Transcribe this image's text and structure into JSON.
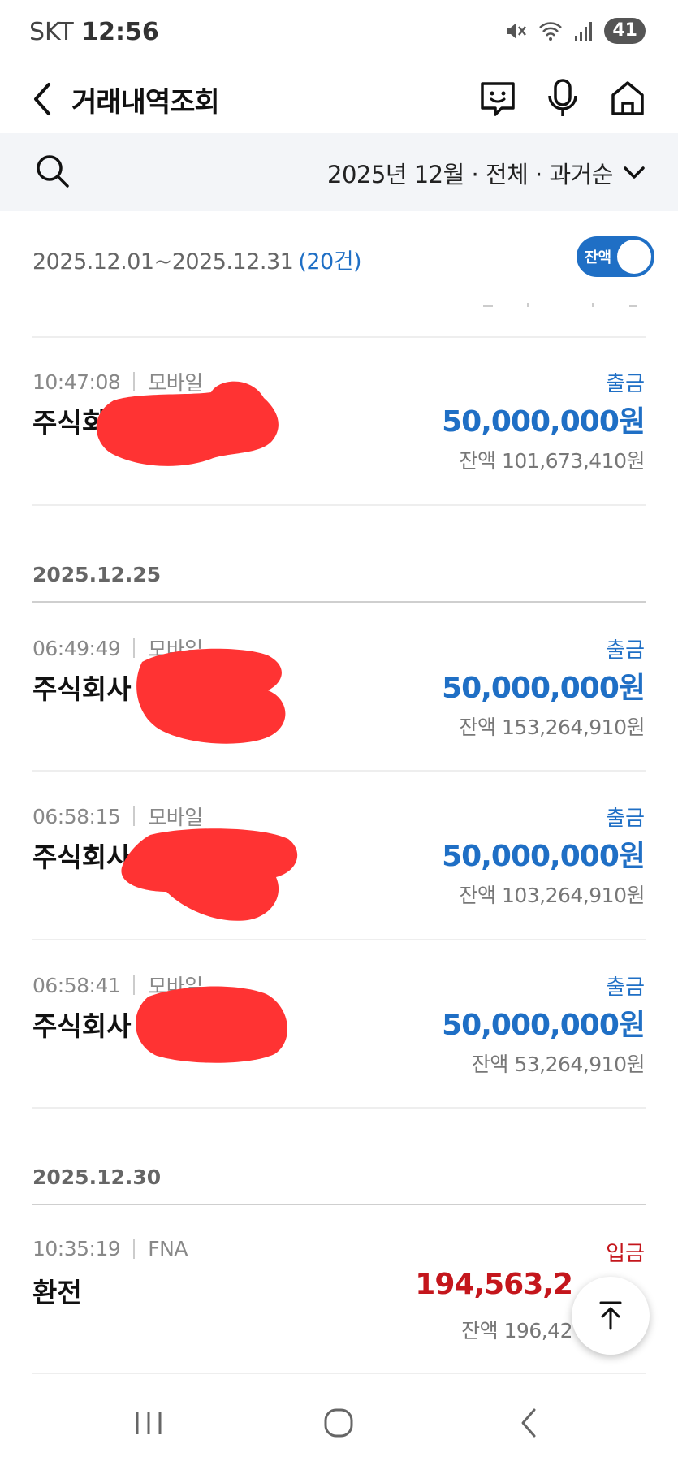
{
  "status": {
    "carrier": "SKT",
    "time": "12:56",
    "battery": "41"
  },
  "header": {
    "title": "거래내역조회"
  },
  "filter": {
    "summary": "2025년 12월 · 전체 · 과거순"
  },
  "range": {
    "period": "2025.12.01~2025.12.31",
    "count": "(20건)",
    "balance_toggle_label": "잔액"
  },
  "transactions": [
    {
      "time": "10:47:08",
      "channel": "모바일",
      "name": "주식회",
      "type": "출금",
      "amount": "50,000,000원",
      "balance": "잔액 101,673,410원"
    },
    {
      "time": "06:49:49",
      "channel": "모바일",
      "name": "주식회사",
      "type": "출금",
      "amount": "50,000,000원",
      "balance": "잔액 153,264,910원"
    },
    {
      "time": "06:58:15",
      "channel": "모바일",
      "name": "주식회사",
      "type": "출금",
      "amount": "50,000,000원",
      "balance": "잔액 103,264,910원"
    },
    {
      "time": "06:58:41",
      "channel": "모바일",
      "name": "주식회사",
      "type": "출금",
      "amount": "50,000,000원",
      "balance": "잔액 53,264,910원"
    },
    {
      "time": "10:35:19",
      "channel": "FNA",
      "name": "환전",
      "type": "입금",
      "amount": "194,563,2",
      "balance": "잔액 196,42"
    }
  ],
  "dates": [
    "2025.12.25",
    "2025.12.30"
  ],
  "colors": {
    "withdrawal": "#1f6fc5",
    "deposit": "#c4161c",
    "redaction": "#ff3333"
  },
  "icons": [
    "back-icon",
    "chatbot-icon",
    "microphone-icon",
    "home-icon",
    "search-icon",
    "chevron-down-icon",
    "scroll-top-icon"
  ]
}
